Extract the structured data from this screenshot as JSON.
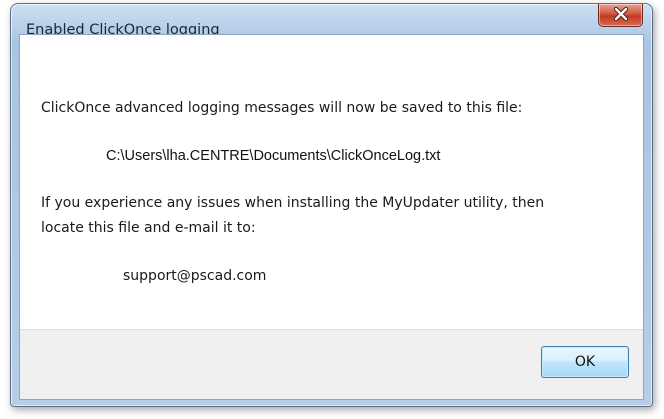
{
  "window": {
    "title": "Enabled ClickOnce logging"
  },
  "titlebar": {
    "close_icon": "close-x-icon"
  },
  "message": {
    "line1": "ClickOnce advanced logging messages will now be saved to this file:",
    "file_path": "C:\\Users\\lha.CENTRE\\Documents\\ClickOnceLog.txt",
    "line2": "If you experience any issues when installing the MyUpdater utility, then",
    "line3": "locate this file and e-mail it to:",
    "email": "support@pscad.com"
  },
  "buttons": {
    "ok_label": "OK"
  },
  "colors": {
    "close_button": "#c94a33",
    "ok_button_border": "#3c7fb1"
  }
}
